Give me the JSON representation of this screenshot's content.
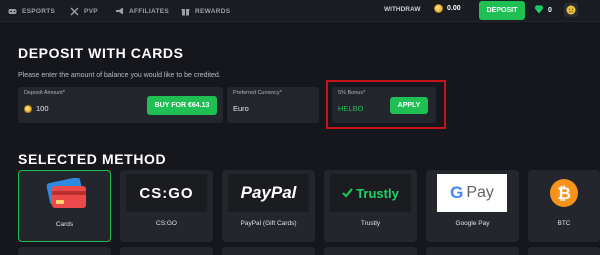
{
  "nav": {
    "esports": "ESPORTS",
    "pvp": "PVP",
    "affiliates": "AFFILIATES",
    "rewards": "REWARDS"
  },
  "header": {
    "withdraw": "WITHDRAW",
    "balance": "0.00",
    "deposit": "DEPOSIT",
    "gems": "0"
  },
  "deposit": {
    "title": "DEPOSIT WITH CARDS",
    "description": "Please enter the amount of balance you would like to be credited.",
    "amount_label": "Deposit Amount*",
    "amount_value": "100",
    "buy_button": "BUY FOR €64.13",
    "currency_label": "Preferred Currency*",
    "currency_value": "Euro",
    "bonus_label": "5% Bonus*",
    "bonus_code": "HELBO",
    "apply_button": "APPLY"
  },
  "methods": {
    "title": "SELECTED METHOD",
    "items": [
      {
        "name": "Cards",
        "icon": "credit-cards-icon"
      },
      {
        "name": "CS:GO",
        "icon": "csgo-logo"
      },
      {
        "name": "PayPal (Gift Cards)",
        "icon": "paypal-logo"
      },
      {
        "name": "Trustly",
        "icon": "trustly-logo"
      },
      {
        "name": "Google Pay",
        "icon": "google-pay-logo"
      },
      {
        "name": "BTC",
        "icon": "bitcoin-icon"
      }
    ],
    "logos": {
      "csgo": "CS:GO",
      "paypal": "PayPal",
      "trustly": "Trustly",
      "gpay": "Pay",
      "btc": "₿"
    }
  },
  "colors": {
    "accent": "#1fbf53",
    "highlight_border": "#c7141a",
    "background": "#15171d",
    "panel": "#23262d"
  }
}
